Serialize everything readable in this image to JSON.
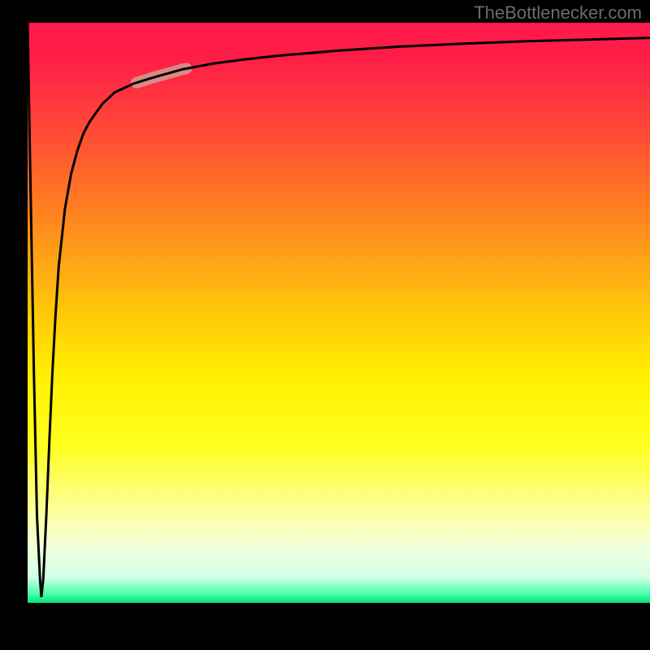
{
  "watermark": "TheBottlenecker.com",
  "chart_data": {
    "type": "line",
    "title": "",
    "xlabel": "",
    "ylabel": "",
    "xlim": [
      0,
      100
    ],
    "ylim": [
      0,
      100
    ],
    "gradient_stops": [
      {
        "offset": 0.0,
        "color": "#ff1a4a"
      },
      {
        "offset": 0.06,
        "color": "#ff1d47"
      },
      {
        "offset": 0.2,
        "color": "#ff4f33"
      },
      {
        "offset": 0.35,
        "color": "#ff8b1d"
      },
      {
        "offset": 0.5,
        "color": "#ffc80a"
      },
      {
        "offset": 0.62,
        "color": "#fff200"
      },
      {
        "offset": 0.73,
        "color": "#ffff20"
      },
      {
        "offset": 0.83,
        "color": "#fdff8e"
      },
      {
        "offset": 0.9,
        "color": "#f3ffda"
      },
      {
        "offset": 0.955,
        "color": "#d5ffe7"
      },
      {
        "offset": 0.985,
        "color": "#48ffa8"
      },
      {
        "offset": 1.0,
        "color": "#05e078"
      }
    ],
    "series": [
      {
        "name": "bottleneck-curve",
        "x": [
          0.0,
          0.5,
          1.0,
          1.5,
          2.0,
          2.2,
          2.5,
          3.0,
          3.5,
          4.0,
          4.5,
          5.0,
          6.0,
          7.0,
          8.0,
          9.0,
          10.0,
          12.0,
          14.0,
          17.0,
          20.0,
          25.0,
          30.0,
          35.0,
          40.0,
          50.0,
          60.0,
          70.0,
          80.0,
          90.0,
          100.0
        ],
        "y": [
          100.0,
          70.0,
          40.0,
          15.0,
          4.0,
          1.0,
          4.0,
          15.0,
          28.0,
          40.0,
          50.0,
          58.0,
          68.0,
          74.0,
          78.0,
          81.0,
          83.0,
          86.0,
          88.0,
          89.5,
          90.5,
          92.0,
          93.0,
          93.7,
          94.3,
          95.2,
          95.9,
          96.4,
          96.8,
          97.1,
          97.4
        ]
      }
    ],
    "highlight": {
      "x_range": [
        17.5,
        25.5
      ],
      "color": "#d88a83",
      "stroke_width": 14
    },
    "curve_stroke": "#000000",
    "curve_width": 3
  }
}
